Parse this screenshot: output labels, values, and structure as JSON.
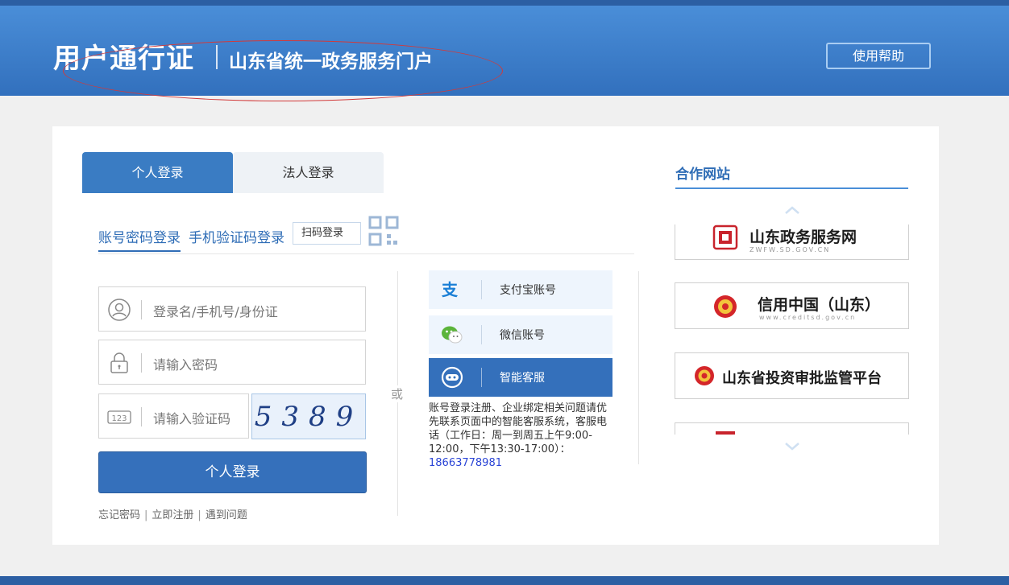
{
  "header": {
    "title": "用户通行证",
    "subtitle": "山东省统一政务服务门户",
    "help_button": "使用帮助"
  },
  "tabs": [
    {
      "label": "个人登录",
      "active": true
    },
    {
      "label": "法人登录",
      "active": false
    }
  ],
  "login_methods": {
    "account_password": "账号密码登录",
    "sms_code": "手机验证码登录",
    "scan": "扫码登录"
  },
  "form": {
    "username_placeholder": "登录名/手机号/身份证",
    "password_placeholder": "请输入密码",
    "captcha_placeholder": "请输入验证码",
    "captcha_image_text": "5389",
    "submit_label": "个人登录"
  },
  "links": {
    "forgot_password": "忘记密码",
    "register": "立即注册",
    "problems": "遇到问题"
  },
  "divider_text": "或",
  "alt_logins": [
    {
      "label": "支付宝账号",
      "icon": "alipay-icon"
    },
    {
      "label": "微信账号",
      "icon": "wechat-icon"
    },
    {
      "label": "智能客服",
      "icon": "chatbot-icon"
    }
  ],
  "support_note": {
    "text": "账号登录注册、企业绑定相关问题请优先联系页面中的智能客服系统，客服电话（工作日：周一到周五上午9:00-12:00，下午13:30-17:00）：",
    "phone": "18663778981"
  },
  "partners": {
    "title": "合作网站",
    "items": [
      {
        "name": "山东政务服务网",
        "url": "ZWFW.SD.GOV.CN"
      },
      {
        "name": "信用中国（山东）",
        "url": "www.creditsd.gov.cn"
      },
      {
        "name": "山东省投资审批监管平台",
        "url": ""
      },
      {
        "name": "",
        "url": ""
      }
    ]
  },
  "colors": {
    "brand_blue": "#3570bb",
    "header_top": "#4a8ed8",
    "link_blue": "#2f6db6",
    "phone_blue": "#2a44d6"
  }
}
